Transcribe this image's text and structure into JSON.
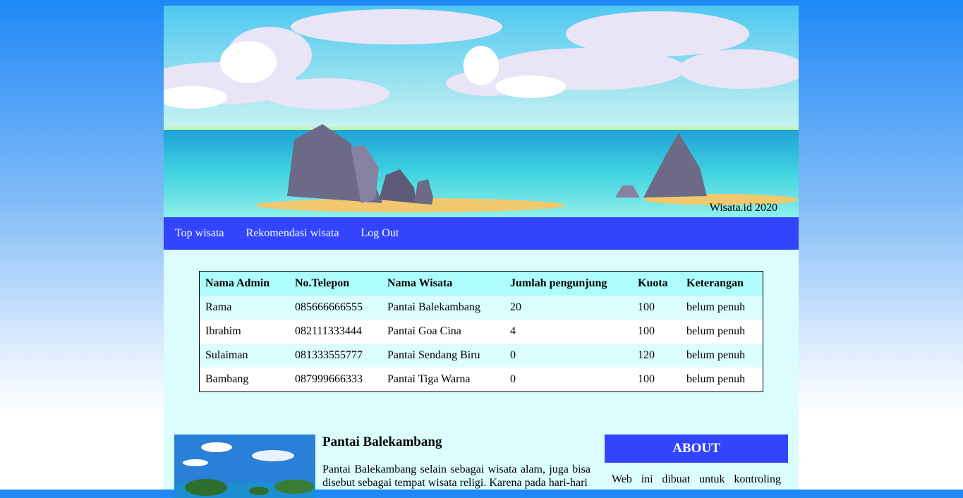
{
  "banner": {
    "caption": "Wisata.id 2020"
  },
  "nav": {
    "items": [
      "Top wisata",
      "Rekomendasi wisata",
      "Log Out"
    ]
  },
  "table": {
    "headers": [
      "Nama Admin",
      "No.Telepon",
      "Nama Wisata",
      "Jumlah pengunjung",
      "Kuota",
      "Keterangan"
    ],
    "rows": [
      [
        "Rama",
        "085666666555",
        "Pantai Balekambang",
        "20",
        "100",
        "belum penuh"
      ],
      [
        "Ibrahim",
        "082111333444",
        "Pantai Goa Cina",
        "4",
        "100",
        "belum penuh"
      ],
      [
        "Sulaiman",
        "081333555777",
        "Pantai Sendang Biru",
        "0",
        "120",
        "belum penuh"
      ],
      [
        "Bambang",
        "087999666333",
        "Pantai Tiga Warna",
        "0",
        "100",
        "belum penuh"
      ]
    ]
  },
  "article": {
    "title": "Pantai Balekambang",
    "text": "Pantai Balekambang selain sebagai wisata alam, juga bisa disebut sebagai tempat wisata religi. Karena pada hari-hari"
  },
  "about": {
    "heading": "ABOUT",
    "text": "Web ini dibuat untuk kontroling"
  }
}
